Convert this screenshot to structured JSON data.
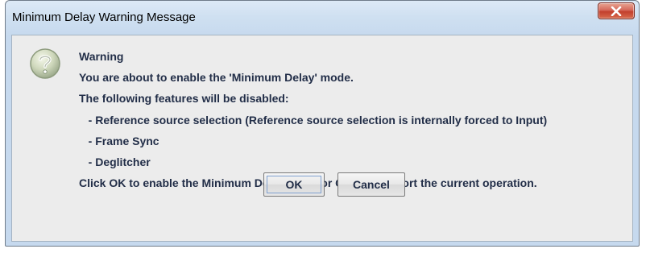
{
  "window": {
    "title": "Minimum Delay Warning Message",
    "close_icon": "close-icon"
  },
  "dialog": {
    "icon": "question-icon",
    "heading": "Warning",
    "lines": [
      "You are about to enable the 'Minimum Delay' mode.",
      "The following features will be disabled:",
      "   - Reference source selection (Reference source selection is internally forced to Input)",
      "   - Frame Sync",
      "   - Deglitcher",
      "Click OK to enable the Minimum Delay mode or Cancel to abort the current operation."
    ]
  },
  "buttons": {
    "ok_label": "OK",
    "cancel_label": "Cancel"
  },
  "colors": {
    "text": "#222e48",
    "client_bg": "#ececec",
    "frame": "#c6d9ee",
    "close_red": "#c2402d"
  }
}
